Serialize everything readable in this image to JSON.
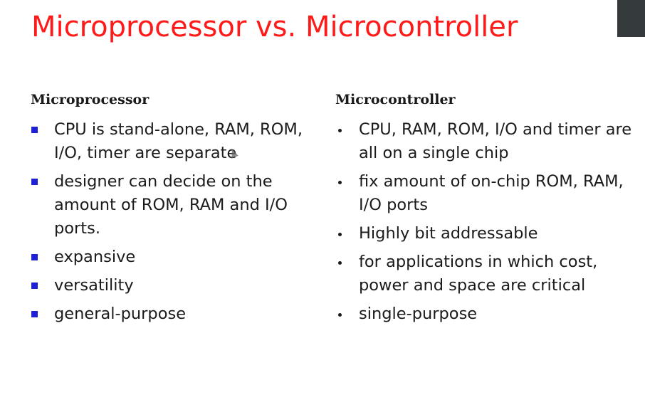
{
  "title": "Microprocessor vs. Microcontroller",
  "microprocessor": {
    "heading": "Microprocessor",
    "items": [
      "CPU is stand-alone,  RAM, ROM, I/O, timer are separate",
      "designer can decide on the amount of ROM, RAM and I/O ports.",
      "expansive",
      "versatility",
      "general-purpose"
    ]
  },
  "microcontroller": {
    "heading": "Microcontroller",
    "items": [
      "CPU, RAM, ROM, I/O and timer are all on a single chip",
      "fix amount of on-chip ROM, RAM, I/O ports",
      "Highly bit addressable",
      "for applications in which cost, power and space are critical",
      "single-purpose"
    ]
  },
  "colors": {
    "title": "#ff1a1a",
    "square_bullet": "#1f1fd6",
    "text": "#1b1b1b"
  }
}
